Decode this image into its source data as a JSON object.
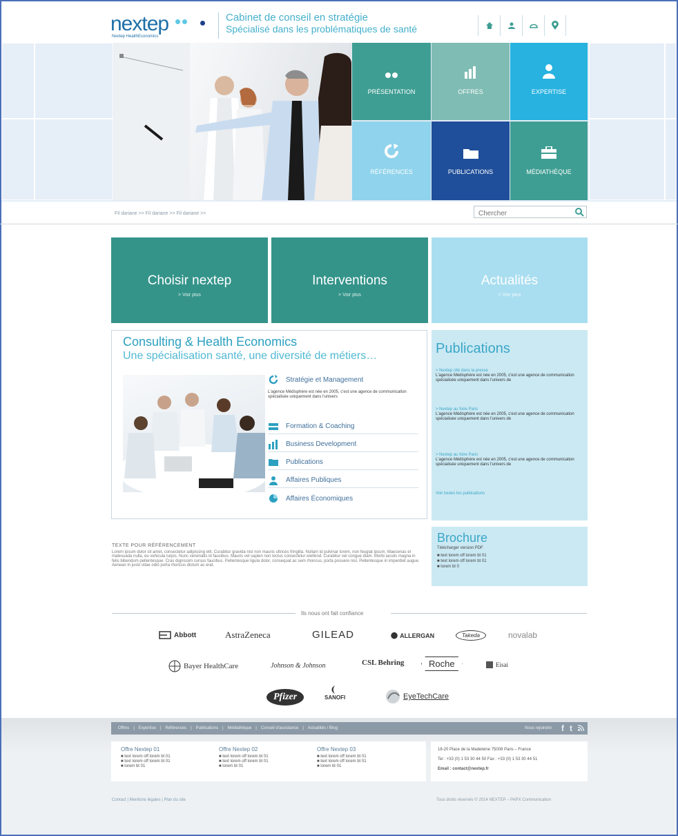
{
  "header": {
    "logo": "nextep",
    "logo_sub": "Nextep HealthEconomics",
    "tagline_1": "Cabinet de conseil en stratégie",
    "tagline_2": "Spécialisé dans les problématiques de santé",
    "icons": [
      "home-icon",
      "user-icon",
      "mail-icon",
      "location-icon"
    ]
  },
  "nav_tiles": [
    {
      "label": "PRÉSENTATION",
      "icon": "dots-icon",
      "color": "#3f9e93"
    },
    {
      "label": "OFFRES",
      "icon": "bar-chart-icon",
      "color": "#7fbcb3"
    },
    {
      "label": "EXPERTISE",
      "icon": "user-icon",
      "color": "#27b2e0"
    },
    {
      "label": "RÉFÉRENCES",
      "icon": "refresh-icon",
      "color": "#8fd3ec"
    },
    {
      "label": "PUBLICATIONS",
      "icon": "folder-icon",
      "color": "#1f4e9a"
    },
    {
      "label": "MÉDIATHÈQUE",
      "icon": "briefcase-icon",
      "color": "#3f9e93"
    }
  ],
  "breadcrumb": "Fil dariane >> Fil dariane >> Fil dariane >>",
  "search": {
    "placeholder": "Chercher"
  },
  "big_tiles": [
    {
      "title": "Choisir nextep",
      "sub": "> Voir plus",
      "color": "#34948a"
    },
    {
      "title": "Interventions",
      "sub": "> Voir plus",
      "color": "#34948a"
    },
    {
      "title": "Actualités",
      "sub": "> Voir plus",
      "color": "#a9def0"
    }
  ],
  "consulting": {
    "title": "Consulting & Health Economics",
    "subtitle": "Une spécialisation santé, une diversité de métiers…",
    "first_desc": "L'agence Médisphère est née en 2005, c'est une agence de communication spécialisée uniquement dans l'univers",
    "services": [
      {
        "label": "Stratégie et Management",
        "icon": "refresh-icon"
      },
      {
        "label": "Formation & Coaching",
        "icon": "book-icon"
      },
      {
        "label": "Business Development",
        "icon": "bar-chart-icon"
      },
      {
        "label": "Publications",
        "icon": "folder-icon"
      },
      {
        "label": "Affaires Publiques",
        "icon": "people-icon"
      },
      {
        "label": "Affaires Économiques",
        "icon": "pie-icon"
      }
    ]
  },
  "publications": {
    "title": "Publications",
    "items": [
      {
        "link": "> Nextep cité dans la presse",
        "text": "L'agence Médisphère est née en 2005, c'est une agence de communication spécialisée uniquement dans l'univers de"
      },
      {
        "link": "> Nextep au foire Paris",
        "text": "L'agence Médisphère est née en 2005, c'est une agence de communication spécialisée uniquement dans l'univers de"
      },
      {
        "link": "> Nextep au foire Paris",
        "text": "L'agence Médisphère est née en 2005, c'est une agence de communication spécialisée uniquement dans l'univers de"
      }
    ],
    "all_link": "Voir toutes les publications"
  },
  "brochure": {
    "title": "Brochure",
    "sub": "Télécharger version PDF",
    "items": [
      "■ text lorem off lorem bt 01",
      "■ text lorem off lorem bt 01",
      "■ lorem bt 0"
    ]
  },
  "seo": {
    "heading": "TEXTE POUR RÉFÉRENCEMENT",
    "text": "Lorem ipsum dolor sit amet, consectetur adipiscing elit. Curabitur gravida nisl non mauris ultrices fringilla. Nullam id pulvinar lorem, non feugiat ipsum. Maecenas et malesuada nulla, eu vehicula turpis. Nunc venenatis id faucibus. Mauris vel sapien non lectus consectetur eleifend. Curabitur vel congue diam. Morbi iaculis magna in felis bibendum pellentesque. Cras dignissim cursus faucibus. Pellentesque ligula dolor, consequat ac sem rhoncus, porta posuere nisi. Pellentesque in imperdiet augue. Aenean in justo vitae odio porta rhoncus dictum ac erat."
  },
  "trust": {
    "label": "Ils nous ont fait confiance",
    "logos": [
      "Abbott",
      "AstraZeneca",
      "GILEAD",
      "ALLERGAN",
      "Takeda",
      "novalab",
      "Bayer HealthCare",
      "Johnson & Johnson",
      "CSL Behring",
      "Roche",
      "Eisai",
      "Pfizer",
      "SANOFI",
      "EyeTechCare"
    ]
  },
  "footer": {
    "nav": [
      "Offres",
      "|",
      "Expertise",
      "|",
      "Références",
      "|",
      "Publications",
      "|",
      "Médiathèque",
      "|",
      "Conseil d'assistance",
      "|",
      "Actualités / Blog"
    ],
    "follow": "Nous rejoindre",
    "cols": [
      {
        "title": "Offre Nextep 01",
        "lines": [
          "■ text lorem off lorem bt 01",
          "■ text lorem off lorem bt 01",
          "■ lorem bt 01"
        ]
      },
      {
        "title": "Offre Nextep 02",
        "lines": [
          "■ text lorem off lorem bt 01",
          "■ text lorem off lorem bt 01",
          "■ lorem bt 01"
        ]
      },
      {
        "title": "Offre Nextep 03",
        "lines": [
          "■ text lorem off lorem bt 01",
          "■ text lorem off lorem bt 01",
          "■ lorem bt 01"
        ]
      }
    ],
    "address": "18-20 Place de la Madeleine 75008 Paris – France",
    "phone": "Tel : +33 (0) 1 53 30 44 50  Fax : +33 (0) 1 53 30 44 51",
    "email": "Email : contact@nextep.fr",
    "links": "Contact  |  Mentions légales  |  Plan du site",
    "copyright": "Tous droits réservés © 2014  NEXTEP – PAPX Communication"
  }
}
